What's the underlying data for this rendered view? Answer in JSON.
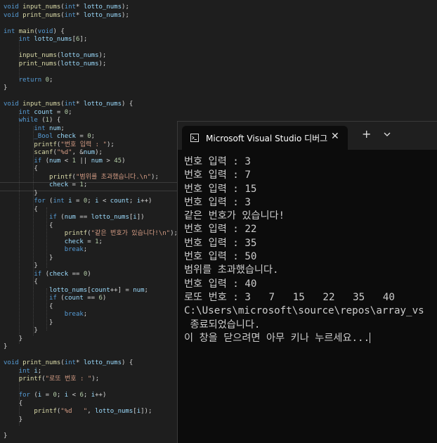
{
  "editor": {
    "lines": [
      {
        "text": "void input_nums(int* lotto_nums);"
      },
      {
        "text": "void print_nums(int* lotto_nums);"
      },
      {
        "text": ""
      },
      {
        "text": "int main(void) {"
      },
      {
        "text": "    int lotto_nums[6];"
      },
      {
        "text": ""
      },
      {
        "text": "    input_nums(lotto_nums);"
      },
      {
        "text": "    print_nums(lotto_nums);"
      },
      {
        "text": ""
      },
      {
        "text": "    return 0;"
      },
      {
        "text": "}"
      },
      {
        "text": ""
      },
      {
        "text": "void input_nums(int* lotto_nums) {"
      },
      {
        "text": "    int count = 0;"
      },
      {
        "text": "    while (1) {"
      },
      {
        "text": "        int num;"
      },
      {
        "text": "        _Bool check = 0;"
      },
      {
        "text": "        printf(\"번호 입력 : \");"
      },
      {
        "text": "        scanf(\"%d\", &num);"
      },
      {
        "text": "        if (num < 1 || num > 45)"
      },
      {
        "text": "        {"
      },
      {
        "text": "            printf(\"범위를 초과했습니다.\\n\");"
      },
      {
        "text": "            check = 1;"
      },
      {
        "text": "        }"
      },
      {
        "text": "        for (int i = 0; i < count; i++)"
      },
      {
        "text": "        {"
      },
      {
        "text": "            if (num == lotto_nums[i])"
      },
      {
        "text": "            {"
      },
      {
        "text": "                printf(\"같은 번호가 있습니다!\\n\");"
      },
      {
        "text": "                check = 1;"
      },
      {
        "text": "                break;"
      },
      {
        "text": "            }"
      },
      {
        "text": "        }"
      },
      {
        "text": "        if (check == 0)"
      },
      {
        "text": "        {"
      },
      {
        "text": "            lotto_nums[count++] = num;"
      },
      {
        "text": "            if (count == 6)"
      },
      {
        "text": "            {"
      },
      {
        "text": "                break;"
      },
      {
        "text": "            }"
      },
      {
        "text": "        }"
      },
      {
        "text": "    }"
      },
      {
        "text": "}"
      },
      {
        "text": ""
      },
      {
        "text": "void print_nums(int* lotto_nums) {"
      },
      {
        "text": "    int i;"
      },
      {
        "text": "    printf(\"로또 번호 : \");"
      },
      {
        "text": ""
      },
      {
        "text": "    for (i = 0; i < 6; i++)"
      },
      {
        "text": "    {"
      },
      {
        "text": "        printf(\"%d   \", lotto_nums[i]);"
      },
      {
        "text": "    }"
      },
      {
        "text": ""
      },
      {
        "text": "}"
      }
    ]
  },
  "terminal": {
    "tab_title": "Microsoft Visual Studio 디버그",
    "tab_icon": "console-icon",
    "close_label": "✕",
    "new_tab_label": "+",
    "dropdown_icon": "chevron-down-icon",
    "output": [
      "번호 입력 : 3",
      "번호 입력 : 7",
      "번호 입력 : 15",
      "번호 입력 : 3",
      "같은 번호가 있습니다!",
      "번호 입력 : 22",
      "번호 입력 : 35",
      "번호 입력 : 50",
      "범위를 초과했습니다.",
      "번호 입력 : 40",
      "로또 번호 : 3   7   15   22   35   40",
      "C:\\Users\\microsoft\\source\\repos\\array_vs",
      " 종료되었습니다.",
      "이 창을 닫으려면 아무 키나 누르세요..."
    ]
  },
  "colors": {
    "editor_bg": "#1e1e1e",
    "terminal_bg": "#0c0c0c",
    "keyword": "#569cd6",
    "function": "#dcdcaa",
    "string": "#d69d85",
    "number": "#b5cea8",
    "variable": "#9cdcfe"
  }
}
